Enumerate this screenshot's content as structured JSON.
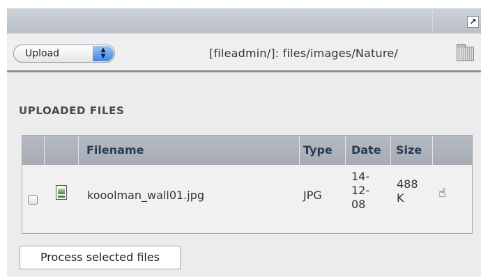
{
  "toolbar": {
    "action_select": {
      "selected": "Upload"
    },
    "path": "[fileadmin/]: files/images/Nature/",
    "folder_icon": "folder-icon",
    "open_icon": "arrow-up-right-icon",
    "open_glyph": "↗"
  },
  "section": {
    "title": "UPLOADED FILES"
  },
  "table": {
    "headers": {
      "filename": "Filename",
      "type": "Type",
      "date": "Date",
      "size": "Size"
    },
    "rows": [
      {
        "filename": "kooolman_wall01.jpg",
        "type": "JPG",
        "date": "14-\n12-\n08",
        "size": "488\nK",
        "icon": "image-file-icon",
        "action_icon": "info-icon",
        "action_glyph": "☝",
        "selected": false
      }
    ]
  },
  "footer": {
    "process_label": "Process selected files"
  }
}
